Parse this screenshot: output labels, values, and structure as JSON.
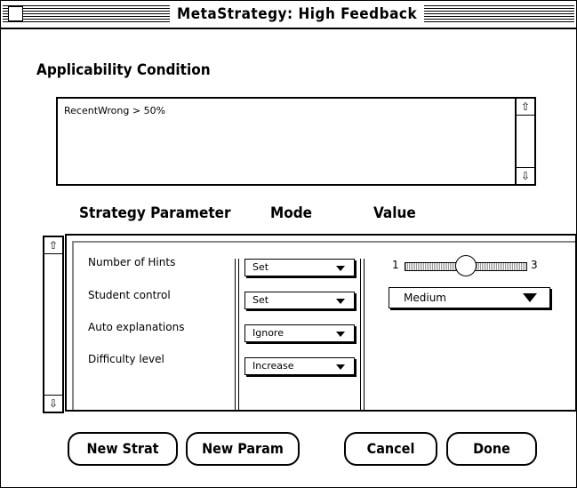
{
  "window": {
    "title": "MetaStrategy: High Feedback"
  },
  "applicability": {
    "heading": "Applicability Condition",
    "condition_text": "RecentWrong > 50%"
  },
  "columns": {
    "parameter": "Strategy Parameter",
    "mode": "Mode",
    "value": "Value"
  },
  "parameters": [
    {
      "label": "Number of Hints",
      "mode": "Set"
    },
    {
      "label": "Student control",
      "mode": "Set"
    },
    {
      "label": "Auto explanations",
      "mode": "Ignore"
    },
    {
      "label": "Difficulty level",
      "mode": "Increase"
    }
  ],
  "values": {
    "slider_min": "1",
    "slider_max": "3",
    "slider_value_fraction": 0.5,
    "student_control_value": "Medium"
  },
  "buttons": {
    "new_strat": "New Strat",
    "new_param": "New Param",
    "cancel": "Cancel",
    "done": "Done"
  },
  "icons": {
    "close_box": "close-box-icon",
    "scroll_up": "up-arrow-icon",
    "scroll_down": "down-arrow-icon",
    "dropdown": "triangle-down-icon"
  }
}
